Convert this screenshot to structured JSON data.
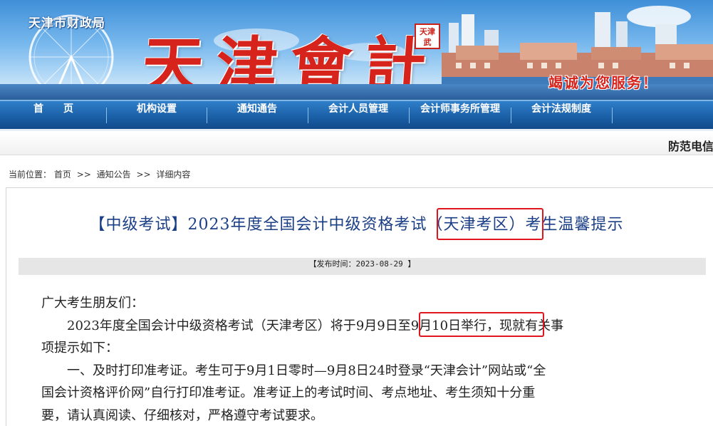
{
  "header": {
    "bureau": "天津市财政局",
    "site_title": "天津會計",
    "seal_text": "天津武",
    "slogan": "竭诚为您服务！"
  },
  "nav": {
    "items": [
      {
        "label": "首　　页"
      },
      {
        "label": "机构设置"
      },
      {
        "label": "通知通告"
      },
      {
        "label": "会计人员管理"
      },
      {
        "label": "会计师事务所管理"
      },
      {
        "label": "会计法规制度"
      }
    ]
  },
  "marquee": {
    "text": "防范电信"
  },
  "breadcrumb": {
    "prefix": "当前位置：",
    "items": [
      "首页",
      "通知公告",
      "详细内容"
    ],
    "separator": ">>"
  },
  "article": {
    "title_part1": "【中级考试】2023年度全国会计中级资格考试",
    "title_highlight": "（天津考区）",
    "title_part2": "考生温馨提示",
    "publish_time": "【发布时间：2023-08-29 】",
    "greeting": "广大考生朋友们：",
    "p1_before": "　　2023年度全国会计中级资格考试（天津考区）将于",
    "p1_highlight": "9月9日至9月10日",
    "p1_after": "举行，现就有关事",
    "p1_line2": "项提示如下：",
    "p2_line1": "　　一、及时打印准考证。考生可于9月1日零时—9月8日24时登录“天津会计”网站或“全",
    "p2_line2": "国会计资格评价网”自行打印准考证。准考证上的考试时间、考点地址、考生须知十分重",
    "p2_line3": "要，请认真阅读、仔细核对，严格遵守考试要求。"
  },
  "colors": {
    "nav_blue": "#1d63ab",
    "title_blue": "#1b3f86",
    "highlight_red": "#e0161f",
    "brand_red": "#d6231b"
  }
}
